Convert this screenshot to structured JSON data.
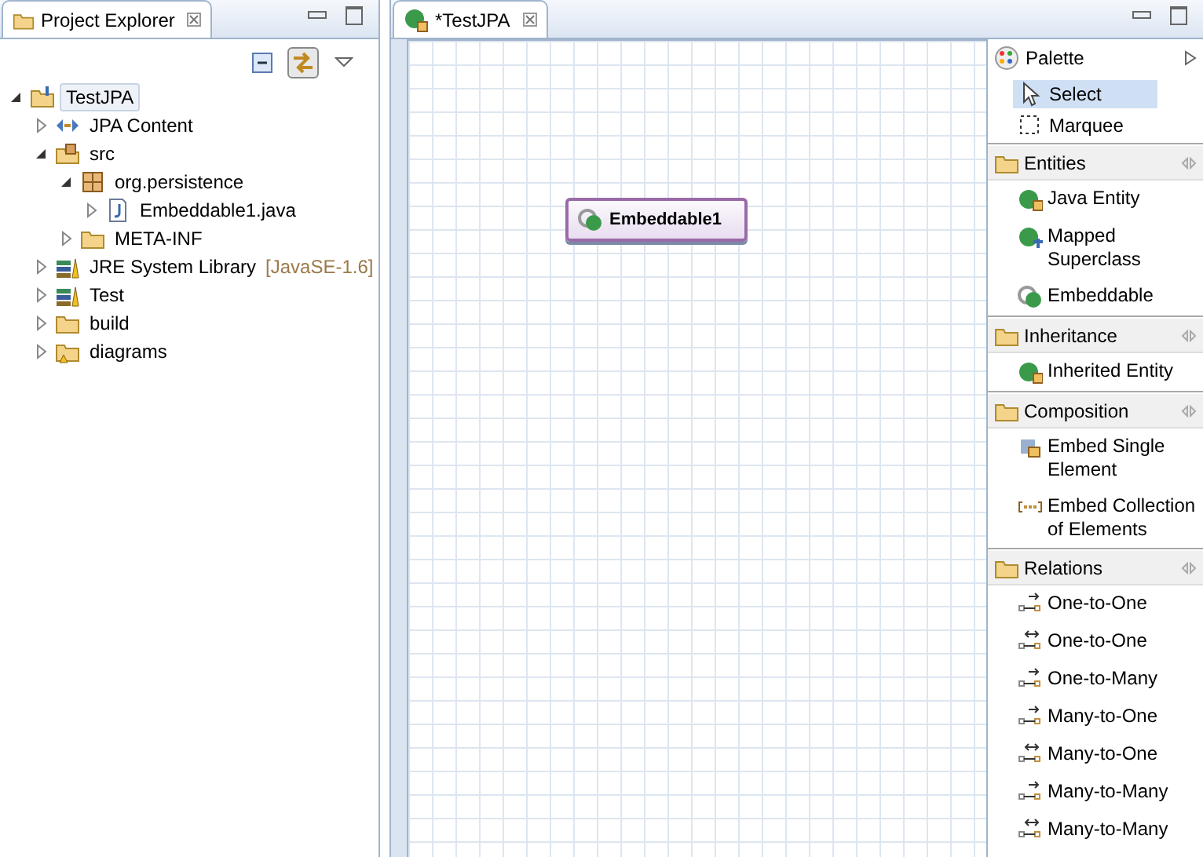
{
  "explorer": {
    "title": "Project Explorer",
    "tree": [
      {
        "label": "TestJPA",
        "kind": "project",
        "expanded": true,
        "selected": true,
        "children": [
          {
            "label": "JPA Content",
            "kind": "jpa",
            "expanded": false,
            "selected": false
          },
          {
            "label": "src",
            "kind": "source-folder",
            "expanded": true,
            "selected": false,
            "children": [
              {
                "label": "org.persistence",
                "kind": "package",
                "expanded": true,
                "selected": false,
                "children": [
                  {
                    "label": "Embeddable1.java",
                    "kind": "java",
                    "expanded": false,
                    "selected": false
                  }
                ]
              },
              {
                "label": "META-INF",
                "kind": "folder",
                "expanded": false,
                "selected": false
              }
            ]
          },
          {
            "label": "JRE System Library",
            "decoration": "[JavaSE-1.6]",
            "kind": "library",
            "expanded": false,
            "selected": false
          },
          {
            "label": "Test",
            "kind": "library",
            "expanded": false,
            "selected": false
          },
          {
            "label": "build",
            "kind": "folder",
            "expanded": false,
            "selected": false
          },
          {
            "label": "diagrams",
            "kind": "folder-warning",
            "expanded": false,
            "selected": false
          }
        ]
      }
    ]
  },
  "editor": {
    "tab": "*TestJPA",
    "nodes": [
      {
        "label": "Embeddable1"
      }
    ]
  },
  "palette": {
    "title": "Palette",
    "tools": [
      {
        "label": "Select",
        "kind": "arrow",
        "selected": true
      },
      {
        "label": "Marquee",
        "kind": "marquee",
        "selected": false
      }
    ],
    "drawers": [
      {
        "title": "Entities",
        "items": [
          {
            "label": "Java Entity",
            "kind": "entity"
          },
          {
            "label": "Mapped Superclass",
            "kind": "mapped"
          },
          {
            "label": "Embeddable",
            "kind": "embeddable"
          }
        ]
      },
      {
        "title": "Inheritance",
        "items": [
          {
            "label": "Inherited Entity",
            "kind": "entity"
          }
        ]
      },
      {
        "title": "Composition",
        "items": [
          {
            "label": "Embed Single Element",
            "kind": "embed-single"
          },
          {
            "label": "Embed Collection of Elements",
            "kind": "embed-collection"
          }
        ]
      },
      {
        "title": "Relations",
        "items": [
          {
            "label": "One-to-One",
            "kind": "relation"
          },
          {
            "label": "One-to-One",
            "kind": "relation-bi"
          },
          {
            "label": "One-to-Many",
            "kind": "relation"
          },
          {
            "label": "Many-to-One",
            "kind": "relation"
          },
          {
            "label": "Many-to-One",
            "kind": "relation-bi"
          },
          {
            "label": "Many-to-Many",
            "kind": "relation"
          },
          {
            "label": "Many-to-Many",
            "kind": "relation-bi"
          }
        ]
      }
    ]
  }
}
